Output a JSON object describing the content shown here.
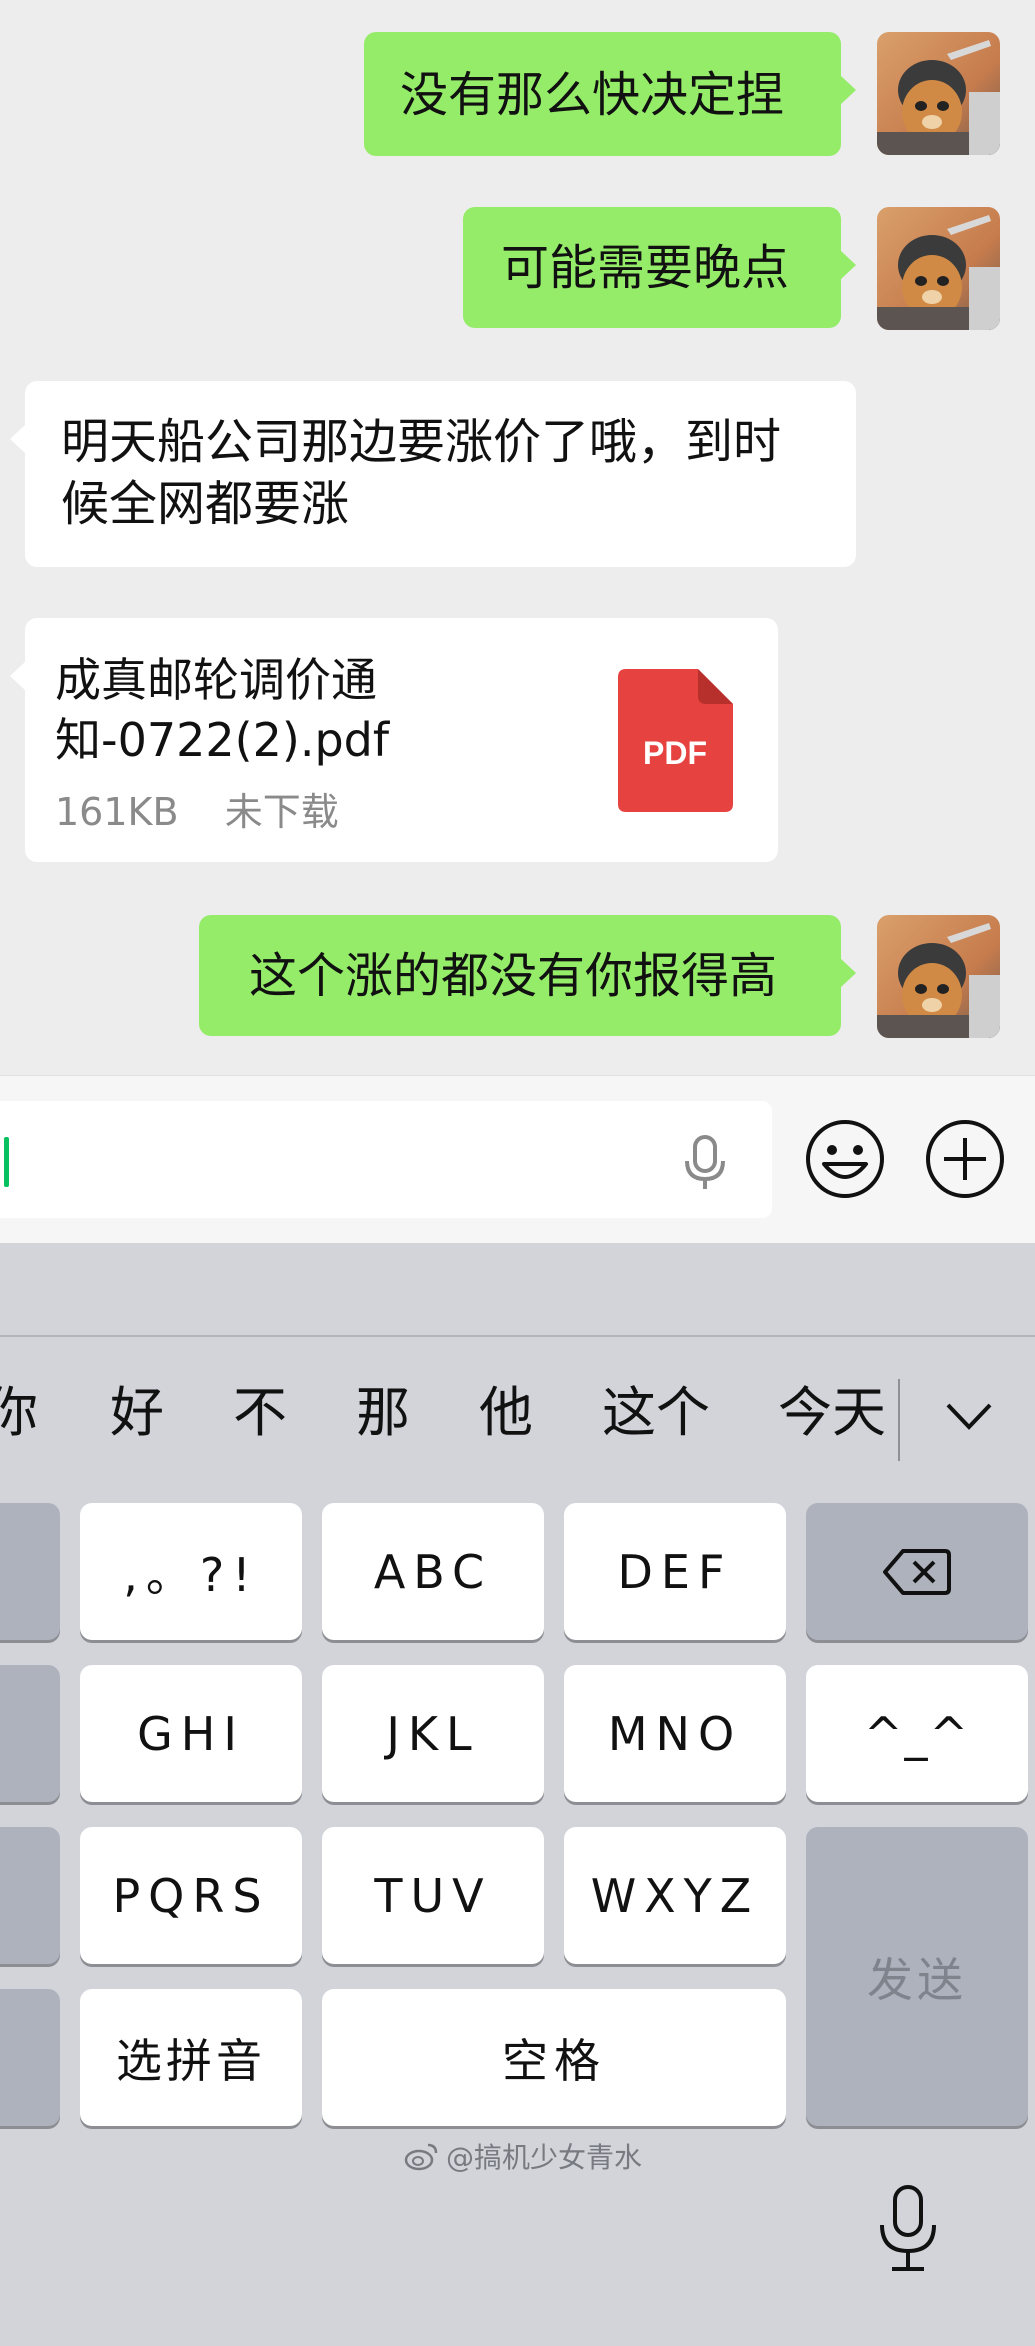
{
  "messages": [
    {
      "type": "text",
      "direction": "out",
      "text": "没有那么快决定捏"
    },
    {
      "type": "text",
      "direction": "out",
      "text": "可能需要晚点"
    },
    {
      "type": "text",
      "direction": "in",
      "lines": [
        "明天船公司那边要涨价了哦，到时",
        "候全网都要涨"
      ]
    },
    {
      "type": "file",
      "direction": "in",
      "name_lines": [
        "成真邮轮调价通",
        "知-0722(2).pdf"
      ],
      "size": "161KB",
      "status": "未下载",
      "badge": "PDF"
    },
    {
      "type": "text",
      "direction": "out",
      "text": "这个涨的都没有你报得高"
    }
  ],
  "input": {
    "value": "",
    "icons": [
      "microphone-icon",
      "emoji-icon",
      "plus-icon"
    ]
  },
  "keyboard": {
    "candidates": [
      "你",
      "好",
      "不",
      "那",
      "他",
      "这个",
      "今天"
    ],
    "keys": {
      "punct": ",。?!",
      "abc": "ABC",
      "def": "DEF",
      "ghi": "GHI",
      "jkl": "JKL",
      "mno": "MNO",
      "emoticon": "^_^",
      "pqrs": "PQRS",
      "tuv": "TUV",
      "wxyz": "WXYZ",
      "send": "发送",
      "pinyin": "选拼音",
      "space": "空格"
    }
  },
  "watermark": "@搞机少女青水",
  "colors": {
    "outgoing_bubble": "#95ec69",
    "incoming_bubble": "#ffffff",
    "chat_bg": "#ededed",
    "keyboard_bg": "#d2d4da",
    "pdf_red": "#e64340"
  }
}
